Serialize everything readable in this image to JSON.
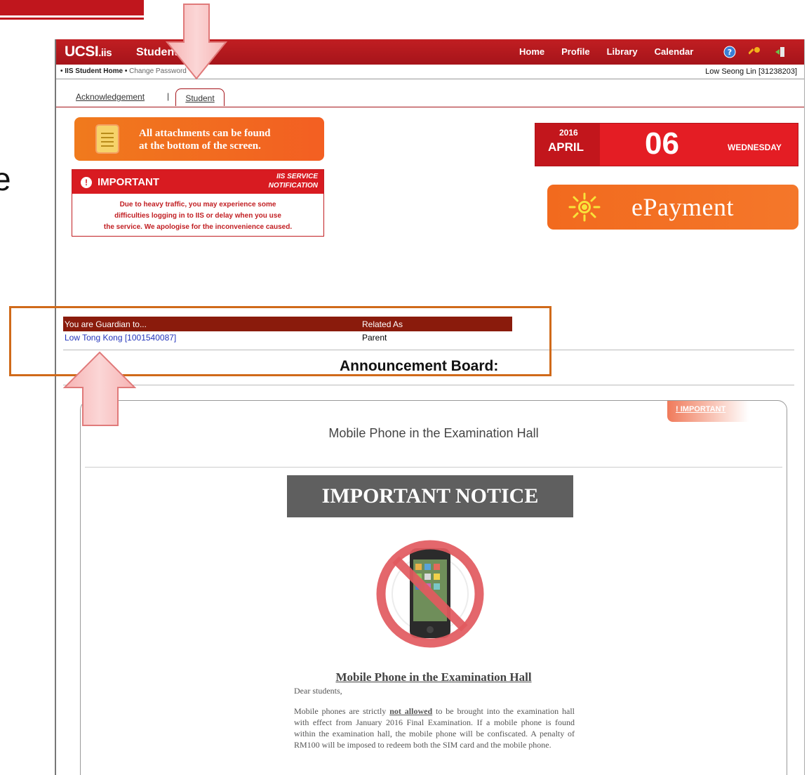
{
  "portal": {
    "logo_main": "UCSI",
    "logo_sub": ".iis",
    "title": "Student Portal",
    "nav": [
      "Home",
      "Profile",
      "Library",
      "Calendar"
    ],
    "icons": [
      "help-icon",
      "key-icon",
      "logout-icon"
    ]
  },
  "breadcrumb": {
    "home": "• IIS Student Home •",
    "current": "Change Password",
    "user": "Low Seong Lin [31238203]"
  },
  "tabs": {
    "acknowledgement": "Acknowledgement",
    "separator": "|",
    "student": "Student"
  },
  "attachments_banner": {
    "line1": "All attachments can be found",
    "line2": "at the bottom of the screen."
  },
  "service_notice": {
    "heading": "IMPORTANT",
    "tag_line1": "IIS SERVICE",
    "tag_line2": "NOTIFICATION",
    "line1": "Due to heavy traffic, you may experience some",
    "line2": "difficulties logging in to IIS or delay when you use",
    "line3": "the service. We apologise for the inconvenience caused."
  },
  "date_widget": {
    "year": "2016",
    "month": "APRIL",
    "day": "06",
    "weekday": "WEDNESDAY"
  },
  "epayment": {
    "label": "ePayment"
  },
  "guardian": {
    "col1": "You are Guardian to...",
    "col2": "Related As",
    "ward": "Low Tong Kong [1001540087]",
    "relation": "Parent"
  },
  "announcement_board": {
    "title": "Announcement Board:",
    "badge": "! IMPORTANT",
    "item_title": "Mobile Phone in the Examination Hall",
    "banner": "IMPORTANT NOTICE",
    "article_title": "Mobile Phone in the Examination Hall",
    "greeting": "Dear students,",
    "body_pre": "Mobile phones are strictly ",
    "body_em": "not allowed",
    "body_post": " to be brought into the examination hall with effect from January 2016 Final Examination. If a mobile phone is found within the examination hall, the mobile phone will be confiscated. A penalty of RM100 will be imposed to redeem both the SIM card and the mobile phone."
  },
  "slide": {
    "letter": "e"
  },
  "colors": {
    "brand_red": "#a5141a",
    "orange": "#f26a1e",
    "highlight": "#d06a1a",
    "arrow_pink": "#f4a6a6"
  }
}
